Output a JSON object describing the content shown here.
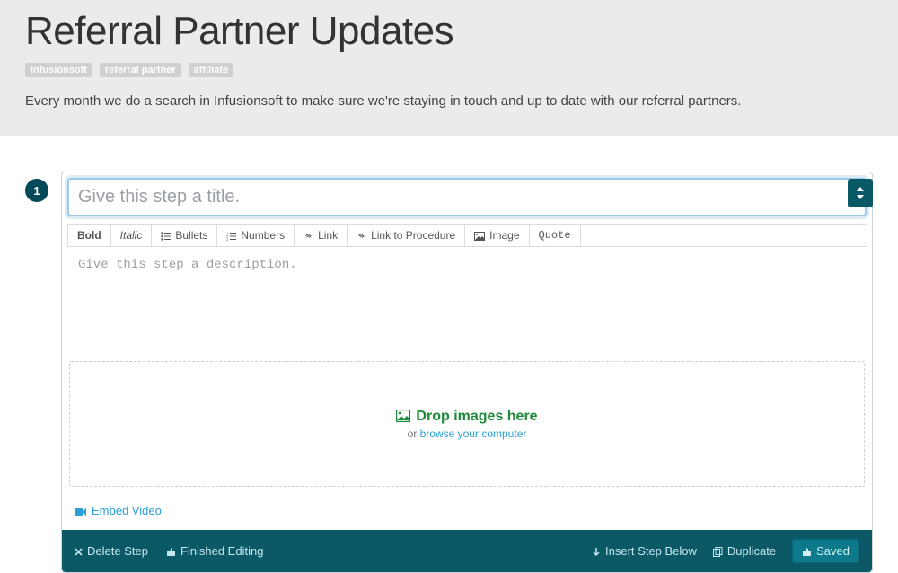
{
  "header": {
    "title": "Referral Partner Updates",
    "tags": [
      "Infusionsoft",
      "referral partner",
      "affiliate"
    ],
    "description": "Every month we do a search in Infusionsoft to make sure we're staying in touch and up to date with our referral partners."
  },
  "step": {
    "number": "1",
    "title_placeholder": "Give this step a title.",
    "toolbar": {
      "bold": "Bold",
      "italic": "Italic",
      "bullets": "Bullets",
      "numbers": "Numbers",
      "link": "Link",
      "procedure": "Link to Procedure",
      "image": "Image",
      "quote": "Quote"
    },
    "description_placeholder": "Give this step a description.",
    "dropzone": {
      "main": "Drop images here",
      "or": "or ",
      "browse": "browse your computer"
    },
    "embed_video": "Embed Video"
  },
  "actions": {
    "delete_step": "Delete Step",
    "finished_editing": "Finished Editing",
    "insert_below": "Insert Step Below",
    "duplicate": "Duplicate",
    "saved": "Saved"
  }
}
